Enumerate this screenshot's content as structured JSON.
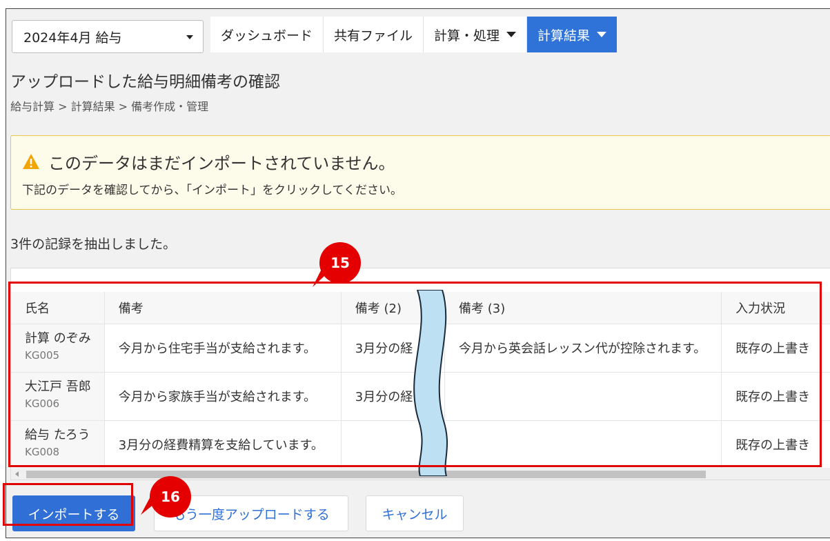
{
  "header": {
    "period_select": "2024年4月 給与",
    "tabs": [
      {
        "label": "ダッシュボード",
        "dropdown": false,
        "active": false
      },
      {
        "label": "共有ファイル",
        "dropdown": false,
        "active": false
      },
      {
        "label": "計算・処理",
        "dropdown": true,
        "active": false
      },
      {
        "label": "計算結果",
        "dropdown": true,
        "active": true
      }
    ]
  },
  "page": {
    "title": "アップロードした給与明細備考の確認",
    "breadcrumb": "給与計算 > 計算結果 > 備考作成・管理"
  },
  "alert": {
    "icon": "warning-icon",
    "title": "このデータはまだインポートされていません。",
    "body": "下記のデータを確認してから、「インポート」をクリックしてください。"
  },
  "summary": "3件の記録を抽出しました。",
  "table": {
    "columns": [
      "氏名",
      "備考",
      "備考 (2)",
      "備考 (3)",
      "入力状況"
    ],
    "rows": [
      {
        "name": "計算 のぞみ",
        "code": "KG005",
        "note1": "今月から住宅手当が支給されます。",
        "note2": "3月分の経",
        "note3": "今月から英会話レッスン代が控除されます。",
        "status": "既存の上書き"
      },
      {
        "name": "大江戸 吾郎",
        "code": "KG006",
        "note1": "今月から家族手当が支給されます。",
        "note2": "3月分の経",
        "note3": "",
        "status": "既存の上書き"
      },
      {
        "name": "給与 たろう",
        "code": "KG008",
        "note1": "3月分の経費精算を支給しています。",
        "note2": "",
        "note3": "",
        "status": "既存の上書き"
      }
    ]
  },
  "annotations": {
    "table_badge": "15",
    "import_badge": "16",
    "color": "#e40000"
  },
  "buttons": {
    "import": "インポートする",
    "reupload": "もう一度アップロードする",
    "cancel": "キャンセル"
  },
  "colors": {
    "primary": "#2f73d9",
    "alert_bg": "#fdfbea",
    "alert_border": "#e6c74b",
    "warning": "#f0a500"
  }
}
